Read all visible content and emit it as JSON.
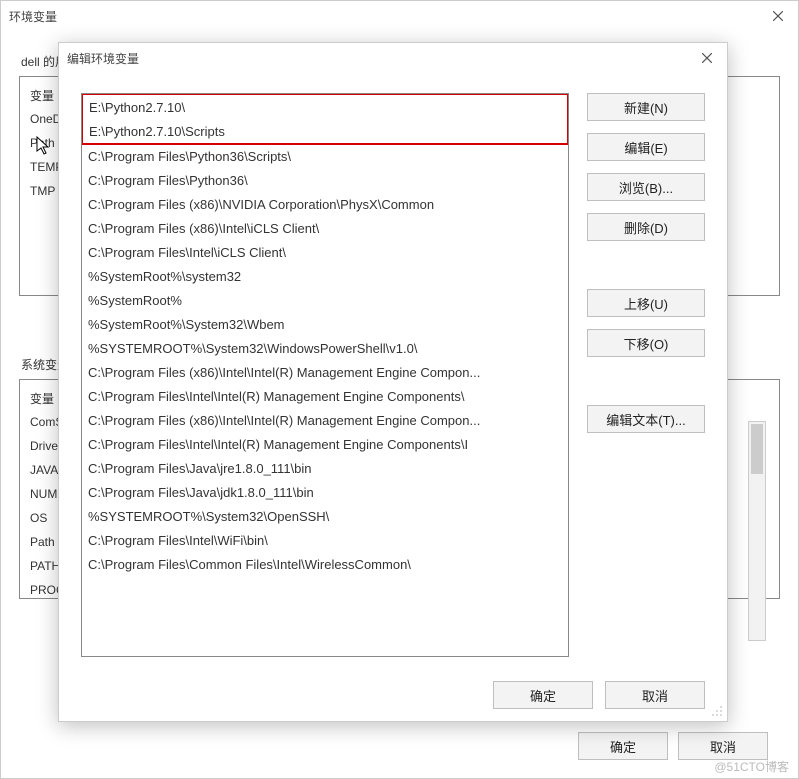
{
  "parent_window": {
    "title": "环境变量",
    "user_section_label": "dell 的用户变量",
    "system_section_label": "系统变量",
    "user_vars_col_header": "变量",
    "user_vars": [
      "OneDrive",
      "Path",
      "TEMP",
      "TMP"
    ],
    "sys_vars_col_header": "变量",
    "sys_vars": [
      "ComSpec",
      "DriverData",
      "JAVA_HOME",
      "NUMBER_OF_PROCESSORS",
      "OS",
      "Path",
      "PATHEXT",
      "PROCESSOR_ARCHITECTURE"
    ],
    "ok": "确定",
    "cancel": "取消"
  },
  "child_window": {
    "title": "编辑环境变量",
    "highlighted_paths": [
      "E:\\Python2.7.10\\",
      "E:\\Python2.7.10\\Scripts"
    ],
    "paths": [
      "C:\\Program Files\\Python36\\Scripts\\",
      "C:\\Program Files\\Python36\\",
      "C:\\Program Files (x86)\\NVIDIA Corporation\\PhysX\\Common",
      "C:\\Program Files (x86)\\Intel\\iCLS Client\\",
      "C:\\Program Files\\Intel\\iCLS Client\\",
      "%SystemRoot%\\system32",
      "%SystemRoot%",
      "%SystemRoot%\\System32\\Wbem",
      "%SYSTEMROOT%\\System32\\WindowsPowerShell\\v1.0\\",
      "C:\\Program Files (x86)\\Intel\\Intel(R) Management Engine Compon...",
      "C:\\Program Files\\Intel\\Intel(R) Management Engine Components\\",
      "C:\\Program Files (x86)\\Intel\\Intel(R) Management Engine Compon...",
      "C:\\Program Files\\Intel\\Intel(R) Management Engine Components\\I",
      "C:\\Program Files\\Java\\jre1.8.0_111\\bin",
      "C:\\Program Files\\Java\\jdk1.8.0_111\\bin",
      "%SYSTEMROOT%\\System32\\OpenSSH\\",
      "C:\\Program Files\\Intel\\WiFi\\bin\\",
      "C:\\Program Files\\Common Files\\Intel\\WirelessCommon\\"
    ],
    "buttons": {
      "new": "新建(N)",
      "edit": "编辑(E)",
      "browse": "浏览(B)...",
      "delete": "删除(D)",
      "up": "上移(U)",
      "down": "下移(O)",
      "edit_text": "编辑文本(T)...",
      "ok": "确定",
      "cancel": "取消"
    }
  },
  "watermark": "@51CTO博客"
}
